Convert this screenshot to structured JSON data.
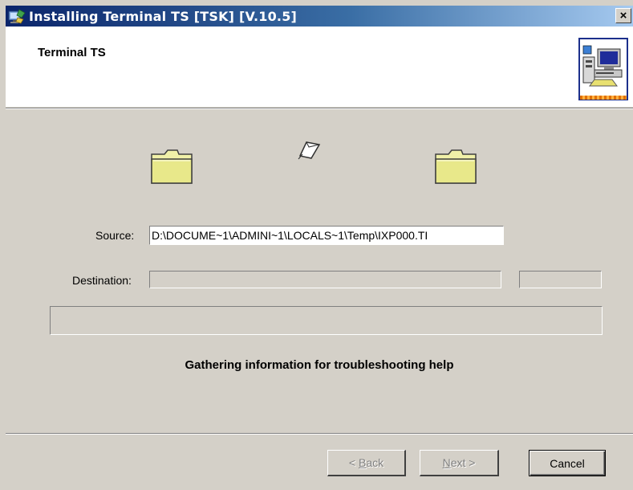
{
  "window": {
    "title": "Installing Terminal TS [TSK] [V.10.5]",
    "close_label": "×"
  },
  "header": {
    "title": "Terminal TS",
    "image_icon": "computer-setup-icon"
  },
  "transfer": {
    "source_folder_icon": "folder-icon",
    "destination_folder_icon": "folder-icon",
    "moving_file_icon": "flying-paper-icon"
  },
  "fields": {
    "source_label": "Source:",
    "source_value": "D:\\DOCUME~1\\ADMINI~1\\LOCALS~1\\Temp\\IXP000.TI",
    "destination_label": "Destination:",
    "destination_value": "",
    "destination_size": ""
  },
  "progress": {
    "fraction": 0
  },
  "status_text": "Gathering information for troubleshooting help",
  "buttons": {
    "back_mnemonic": "B",
    "back_rest": "ack",
    "back_prefix": "< ",
    "next_mnemonic": "N",
    "next_rest": "ext >",
    "cancel_label": "Cancel"
  },
  "colors": {
    "dialog_bg": "#d4d0c8",
    "title_gradient_start": "#0a246a",
    "title_gradient_end": "#a6caf0",
    "folder_fill": "#e8e88a"
  }
}
